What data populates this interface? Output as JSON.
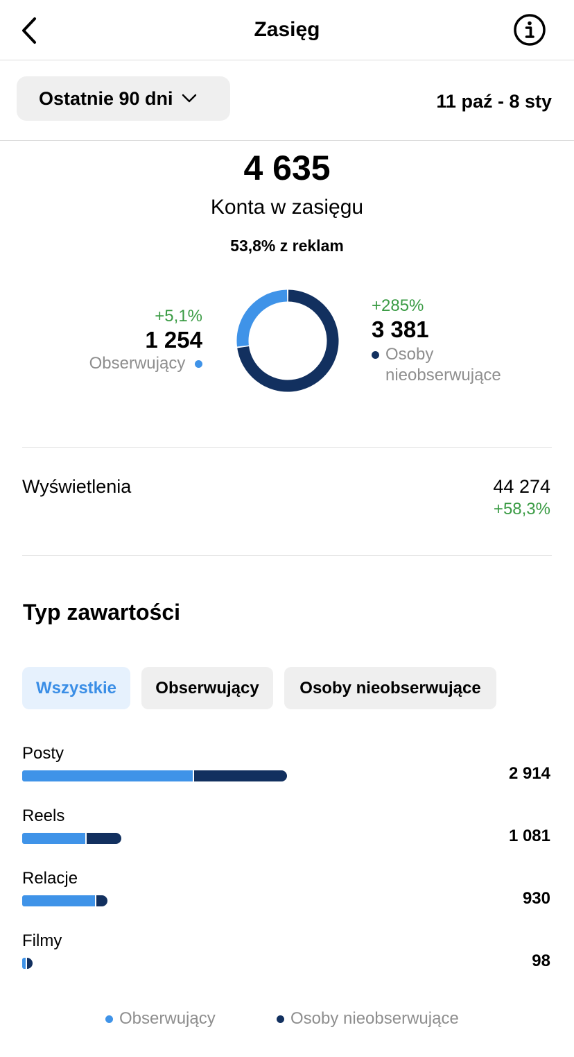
{
  "header": {
    "title": "Zasięg",
    "back_icon": "chevron-left-icon",
    "info_icon": "info-circle-icon"
  },
  "range": {
    "selected": "Ostatnie 90 dni",
    "dates": "11 paź - 8 sty"
  },
  "summary": {
    "total": "4 635",
    "total_label": "Konta w zasięgu",
    "ads_share": "53,8% z reklam"
  },
  "followers": {
    "change": "+5,1%",
    "value": "1 254",
    "label": "Obserwujący"
  },
  "non_followers": {
    "change": "+285%",
    "value": "3 381",
    "label_line1": "Osoby",
    "label_line2": "nieobserwujące"
  },
  "views": {
    "label": "Wyświetlenia",
    "value": "44 274",
    "change": "+58,3%"
  },
  "content_type": {
    "title": "Typ zawartości",
    "tabs": [
      "Wszystkie",
      "Obserwujący",
      "Osoby nieobserwujące"
    ],
    "active_tab": 0
  },
  "chart_data": {
    "type": "bar",
    "stacked": true,
    "orientation": "horizontal",
    "categories": [
      "Posty",
      "Reels",
      "Relacje",
      "Filmy"
    ],
    "totals_printed": [
      "2 914",
      "1 081",
      "930",
      "98"
    ],
    "totals": [
      2914,
      1081,
      930,
      98
    ],
    "series": [
      {
        "name": "Obserwujący",
        "color": "#3f93e8",
        "values": [
          1890,
          695,
          805,
          40
        ]
      },
      {
        "name": "Osoby nieobserwujące",
        "color": "#12305f",
        "values": [
          1024,
          386,
          125,
          58
        ]
      }
    ],
    "donut": {
      "labels": [
        "Obserwujący",
        "Osoby nieobserwujące"
      ],
      "values": [
        1254,
        3381
      ],
      "colors": [
        "#3f93e8",
        "#12305f"
      ]
    }
  },
  "legend": {
    "followers": "Obserwujący",
    "non_followers": "Osoby nieobserwujące"
  },
  "colors": {
    "accent_light": "#3f93e8",
    "accent_dark": "#12305f",
    "positive": "#3a9b44",
    "muted": "#8e8e8e"
  }
}
